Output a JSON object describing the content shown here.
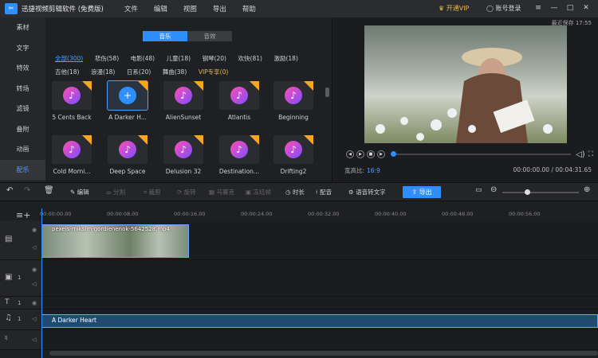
{
  "app": {
    "title": "迅捷视频剪辑软件 (免费版)",
    "menus": [
      "文件",
      "编辑",
      "视图",
      "导出",
      "帮助"
    ],
    "vip": "开通VIP",
    "login": "账号登录",
    "last_saved": "最近保存 17:55"
  },
  "nav": [
    "素材",
    "文字",
    "特效",
    "转场",
    "滤镜",
    "叠附",
    "动画",
    "配乐"
  ],
  "nav_active": 7,
  "library": {
    "tabs": [
      "音乐",
      "音效"
    ],
    "active_tab": 0,
    "categories": [
      "全部(300)",
      "悲伤(58)",
      "电影(48)",
      "儿童(18)",
      "钢琴(20)",
      "欢快(81)",
      "激励(18)",
      "吉他(18)",
      "浪漫(18)",
      "日系(20)",
      "舞曲(38)",
      "VIP专享(0)"
    ],
    "items": [
      "5 Cents Back",
      "A Darker H...",
      "AlienSunset",
      "Atlantis",
      "Beginning",
      "Cold Morni...",
      "Deep Space",
      "Delusion 32",
      "Destination...",
      "Drifting2"
    ],
    "selected": 1
  },
  "preview": {
    "aspect_label": "宽高比:",
    "aspect_value": "16:9",
    "timecode": "00:00:00.00 / 00:04:31.65",
    "progress": 0
  },
  "toolbar": {
    "edit": "编辑",
    "split": "分割",
    "crop": "裁剪",
    "mosaic": "马赛克",
    "freeze": "冻结帧",
    "duration": "时长",
    "dub": "配音",
    "tts": "语音转文字",
    "export": "导出",
    "rotate": "旋转"
  },
  "ruler": [
    "00:00:00.00",
    "00:00:08.00",
    "00:00:16.00",
    "00:00:24.00",
    "00:00:32.00",
    "00:00:40.00",
    "00:00:48.00",
    "00:00:56.00"
  ],
  "tracks": {
    "video_clip": "pexels-miksim-gordienenok-5642528.mp4",
    "audio_clip": "A Darker Heart",
    "badge": "1"
  }
}
